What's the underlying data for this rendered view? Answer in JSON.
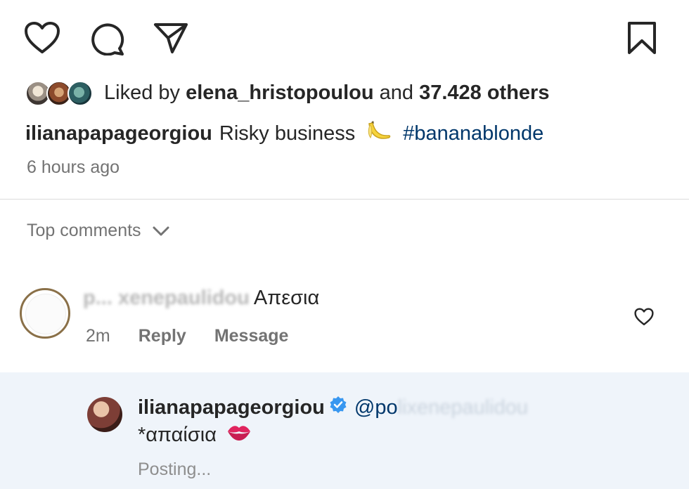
{
  "actions": {
    "like_icon": "heart-outline",
    "comment_icon": "speech-bubble-outline",
    "share_icon": "paper-plane-outline",
    "save_icon": "bookmark-outline"
  },
  "likes": {
    "prefix": "Liked by ",
    "user": "elena_hristopoulou",
    "middle": " and ",
    "count": "37.428 others"
  },
  "caption": {
    "username": "ilianapapageorgiou",
    "text": "Risky business",
    "emoji": "🍌",
    "hashtag": "#bananablonde"
  },
  "post_time": "6 hours ago",
  "comments_header": {
    "label": "Top comments",
    "icon": "chevron-down"
  },
  "comment": {
    "username_obscured": "p... xenepaulidou",
    "text": "Απεσια",
    "time": "2m",
    "reply_label": "Reply",
    "message_label": "Message",
    "like_icon": "heart-outline"
  },
  "reply": {
    "username": "ilianapapageorgiou",
    "verified_icon": "verified-badge",
    "mention_visible": "@po",
    "mention_obscured": "lixenepaulidou",
    "text": "*απαίσια",
    "emoji": "💋",
    "status": "Posting..."
  },
  "colors": {
    "text": "#262626",
    "secondary": "#737373",
    "link": "#00376b",
    "verified": "#3897f0",
    "reply_bg": "#eff4fa"
  }
}
